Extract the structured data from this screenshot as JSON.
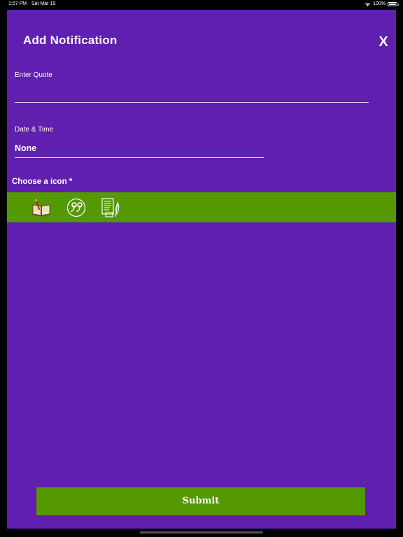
{
  "status_bar": {
    "time": "1:57 PM",
    "date": "Sat Mar 19",
    "battery": "100%"
  },
  "sheet": {
    "title": "Add Notification",
    "close_label": "X",
    "quote": {
      "label": "Enter Quote",
      "value": ""
    },
    "date_time": {
      "label": "Date & Time",
      "value": "None"
    },
    "icon_chooser": {
      "label": "Choose a icon *",
      "icons": [
        "open-book-pen-icon",
        "quote-circle-icon",
        "document-feather-icon"
      ]
    },
    "submit_label": "Submit"
  },
  "colors": {
    "background": "#601fae",
    "accent_green": "#549802",
    "text": "#ffffff"
  }
}
